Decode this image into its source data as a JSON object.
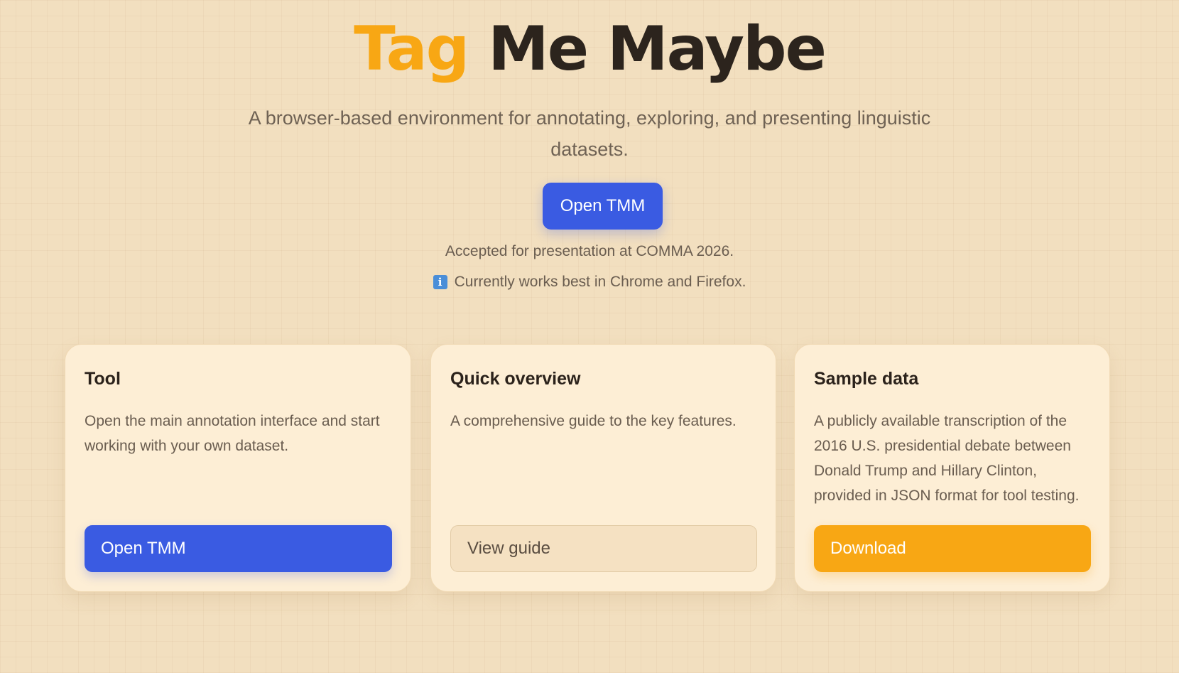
{
  "hero": {
    "title_accent": "Tag",
    "title_rest": " Me Maybe",
    "subtitle": "A browser-based environment for annotating, exploring, and presenting linguistic datasets.",
    "cta_label": "Open TMM",
    "note_accepted": "Accepted for presentation at COMMA 2026.",
    "note_browser": "Currently works best in Chrome and Firefox.",
    "info_icon_glyph": "i"
  },
  "cards": [
    {
      "title": "Tool",
      "description": "Open the main annotation interface and start working with your own dataset.",
      "button_label": "Open TMM"
    },
    {
      "title": "Quick overview",
      "description": "A comprehensive guide to the key features.",
      "button_label": "View guide"
    },
    {
      "title": "Sample data",
      "description": "A publicly available transcription of the 2016 U.S. presidential debate between Donald Trump and Hillary Clinton, provided in JSON format for tool testing.",
      "button_label": "Download"
    }
  ],
  "colors": {
    "background": "#f2dfbf",
    "accent_orange": "#f8a714",
    "primary_blue": "#3a5be2",
    "card_background": "#fdeed5",
    "title_dark": "#2c241d"
  },
  "icons": {
    "info": "info-icon"
  }
}
